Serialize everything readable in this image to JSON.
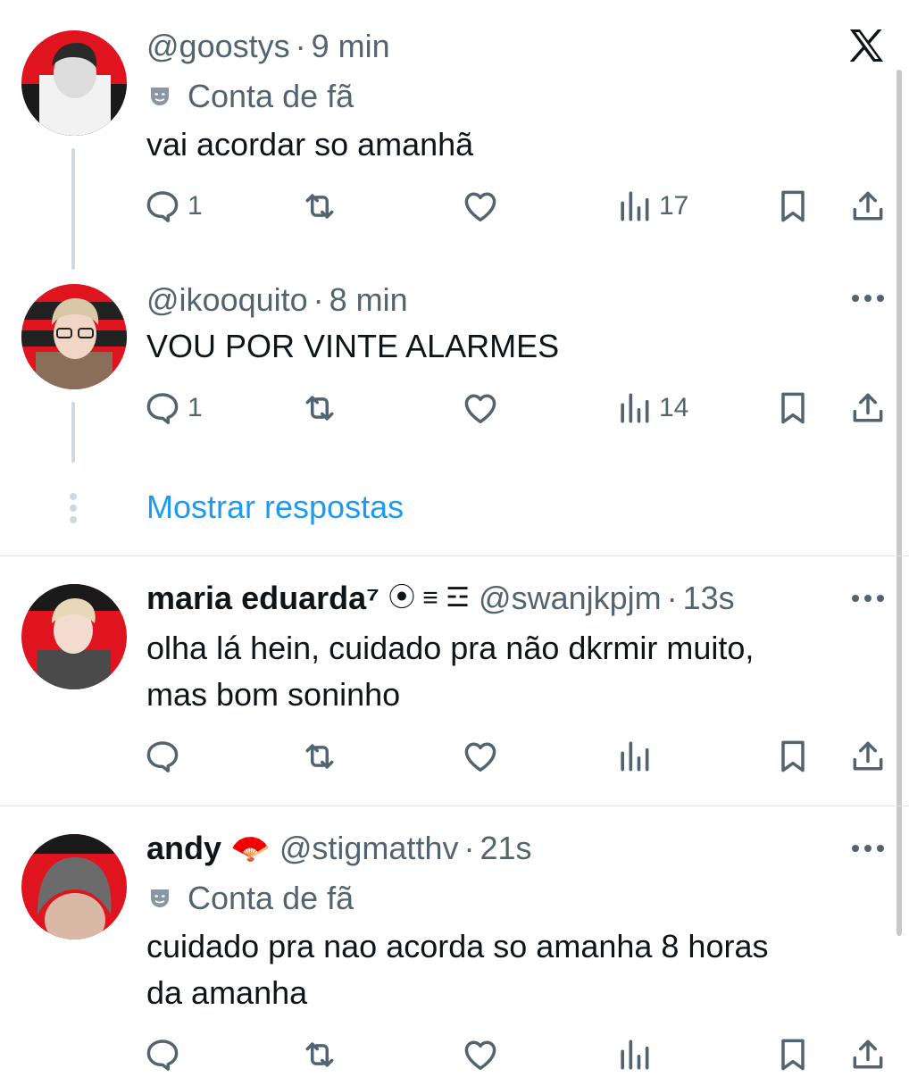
{
  "close_icon": "x-logo-icon",
  "show_replies": "Mostrar respostas",
  "replies": [
    {
      "handle": "@goostys",
      "separator": "·",
      "time": "9 min",
      "fan_label": "Conta de fã",
      "text_lines": [
        "vai acordar so amanhã"
      ],
      "reply_count": "1",
      "views": "17"
    },
    {
      "handle": "@ikooquito",
      "separator": "·",
      "time": "8 min",
      "text_lines": [
        "VOU POR VINTE ALARMES"
      ],
      "reply_count": "1",
      "views": "14"
    },
    {
      "name": "maria eduarda⁷",
      "name_badges": "⦿ ≡ ☲",
      "handle": "@swanjkpjm",
      "separator": "·",
      "time": "13s",
      "text_lines": [
        "olha lá hein, cuidado pra não dkrmir muito,",
        "mas bom soninho"
      ]
    },
    {
      "name": "andy",
      "name_emoji": "🪭",
      "handle": "@stigmatthv",
      "separator": "·",
      "time": "21s",
      "fan_label": "Conta de fã",
      "text_lines": [
        "cuidado pra nao acorda so amanha 8 horas",
        "da amanha"
      ]
    }
  ],
  "colors": {
    "link": "#1d9bf0",
    "muted": "#536471",
    "text": "#0f1419",
    "avatar_bg": "#e0141e"
  }
}
